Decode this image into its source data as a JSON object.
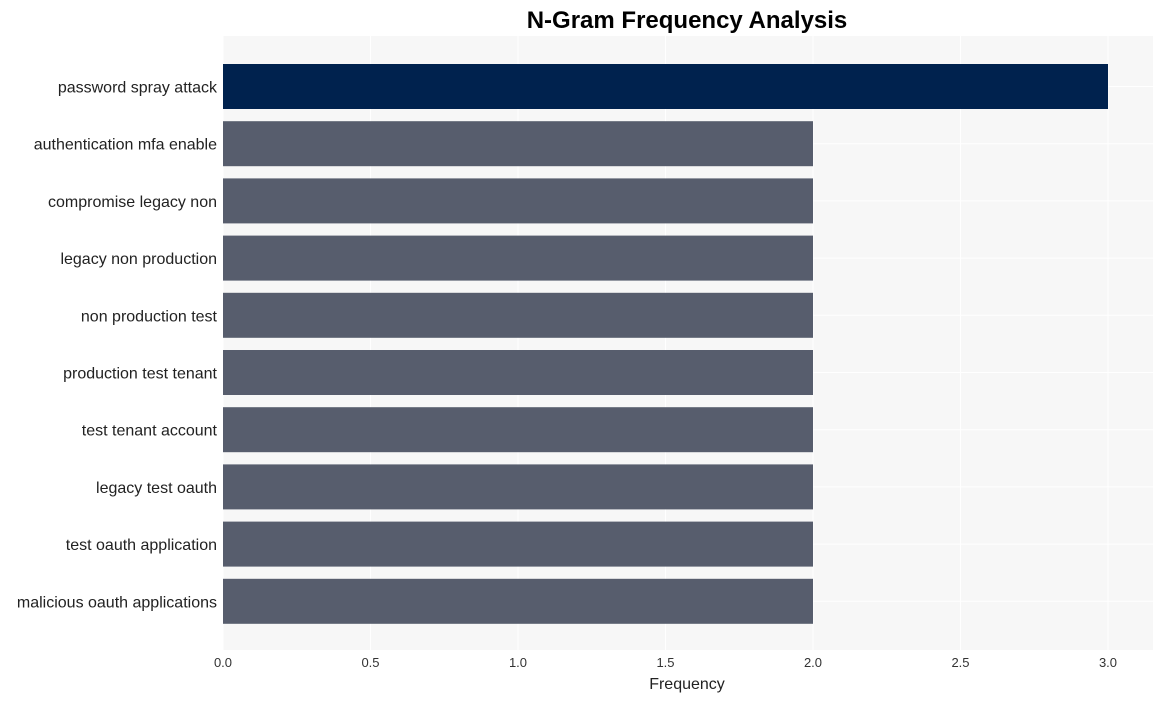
{
  "chart_data": {
    "type": "bar",
    "orientation": "horizontal",
    "title": "N-Gram Frequency Analysis",
    "xlabel": "Frequency",
    "ylabel": "",
    "xlim": [
      0,
      3.15
    ],
    "x_ticks": [
      "0.0",
      "0.5",
      "1.0",
      "1.5",
      "2.0",
      "2.5",
      "3.0"
    ],
    "x_tick_values": [
      0,
      0.5,
      1.0,
      1.5,
      2.0,
      2.5,
      3.0
    ],
    "grid": true,
    "legend": "none",
    "categories": [
      "password spray attack",
      "authentication mfa enable",
      "compromise legacy non",
      "legacy non production",
      "non production test",
      "production test tenant",
      "test tenant account",
      "legacy test oauth",
      "test oauth application",
      "malicious oauth applications"
    ],
    "values": [
      3,
      2,
      2,
      2,
      2,
      2,
      2,
      2,
      2,
      2
    ],
    "colors": {
      "highlight": "#00224e",
      "default": "#575d6d",
      "plot_background": "#f7f7f7",
      "grid": "#ffffff"
    }
  }
}
